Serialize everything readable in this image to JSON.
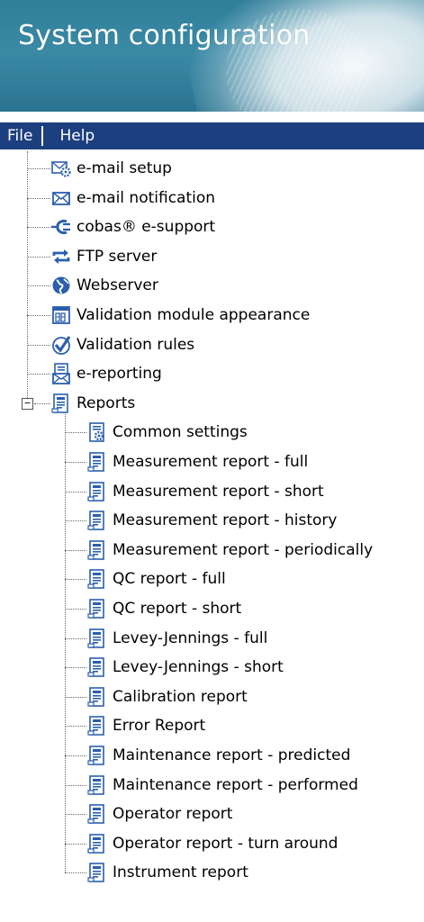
{
  "window": {
    "title": "System configuration"
  },
  "menu": {
    "file": "File",
    "help": "Help"
  },
  "tree": {
    "top_items": [
      {
        "label": "e-mail setup",
        "icon": "email-setup-icon"
      },
      {
        "label": "e-mail notification",
        "icon": "envelope-icon"
      },
      {
        "label": "cobas® e-support",
        "icon": "plug-icon"
      },
      {
        "label": "FTP server",
        "icon": "sync-arrows-icon"
      },
      {
        "label": "Webserver",
        "icon": "globe-icon"
      },
      {
        "label": "Validation module appearance",
        "icon": "grid-window-icon"
      },
      {
        "label": "Validation rules",
        "icon": "checkmark-icon"
      },
      {
        "label": "e-reporting",
        "icon": "report-envelope-icon"
      }
    ],
    "reports": {
      "label": "Reports",
      "icon": "report-icon",
      "expanded_symbol": "−",
      "children": [
        {
          "label": "Common settings",
          "icon": "report-gear-icon"
        },
        {
          "label": "Measurement report - full",
          "icon": "report-icon"
        },
        {
          "label": "Measurement report - short",
          "icon": "report-icon"
        },
        {
          "label": "Measurement report - history",
          "icon": "report-icon"
        },
        {
          "label": "Measurement report - periodically",
          "icon": "report-icon"
        },
        {
          "label": "QC report - full",
          "icon": "report-icon"
        },
        {
          "label": "QC report - short",
          "icon": "report-icon"
        },
        {
          "label": "Levey-Jennings - full",
          "icon": "report-icon"
        },
        {
          "label": "Levey-Jennings - short",
          "icon": "report-icon"
        },
        {
          "label": "Calibration report",
          "icon": "report-icon"
        },
        {
          "label": "Error Report",
          "icon": "report-icon"
        },
        {
          "label": "Maintenance report - predicted",
          "icon": "report-icon"
        },
        {
          "label": "Maintenance report - performed",
          "icon": "report-icon"
        },
        {
          "label": "Operator report",
          "icon": "report-icon"
        },
        {
          "label": "Operator report - turn around",
          "icon": "report-icon"
        },
        {
          "label": "Instrument report",
          "icon": "report-icon"
        }
      ]
    }
  },
  "colors": {
    "header": "#2f7e9a",
    "menubar": "#1c3f7f",
    "icon_blue": "#2b5fae"
  }
}
